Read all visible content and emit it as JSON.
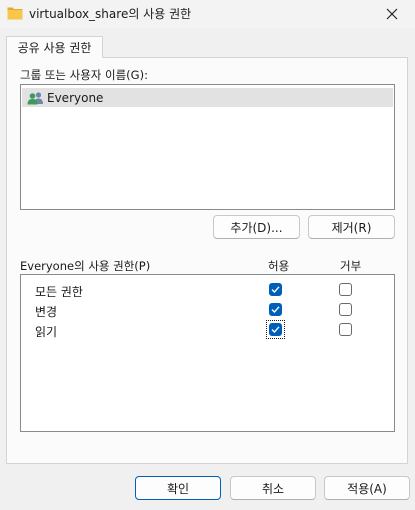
{
  "window": {
    "title": "virtualbox_share의 사용 권한",
    "folder_icon": "folder-icon",
    "close_icon": "close-icon"
  },
  "tab": {
    "label": "공유 사용 권한"
  },
  "group_section": {
    "label": "그룹 또는 사용자 이름(G):",
    "items": [
      {
        "icon": "users-icon",
        "label": "Everyone",
        "selected": true
      }
    ]
  },
  "group_buttons": {
    "add": "추가(D)...",
    "remove": "제거(R)"
  },
  "permissions": {
    "label": "Everyone의 사용 권한(P)",
    "allow_header": "허용",
    "deny_header": "거부",
    "rows": [
      {
        "name": "모든 권한",
        "allow": true,
        "deny": false
      },
      {
        "name": "변경",
        "allow": true,
        "deny": false
      },
      {
        "name": "읽기",
        "allow": true,
        "deny": false
      }
    ]
  },
  "footer": {
    "ok": "확인",
    "cancel": "취소",
    "apply": "적용(A)"
  },
  "colors": {
    "accent": "#005fb8",
    "selection": "#e2e2e2",
    "folder": "#f7c64a"
  }
}
